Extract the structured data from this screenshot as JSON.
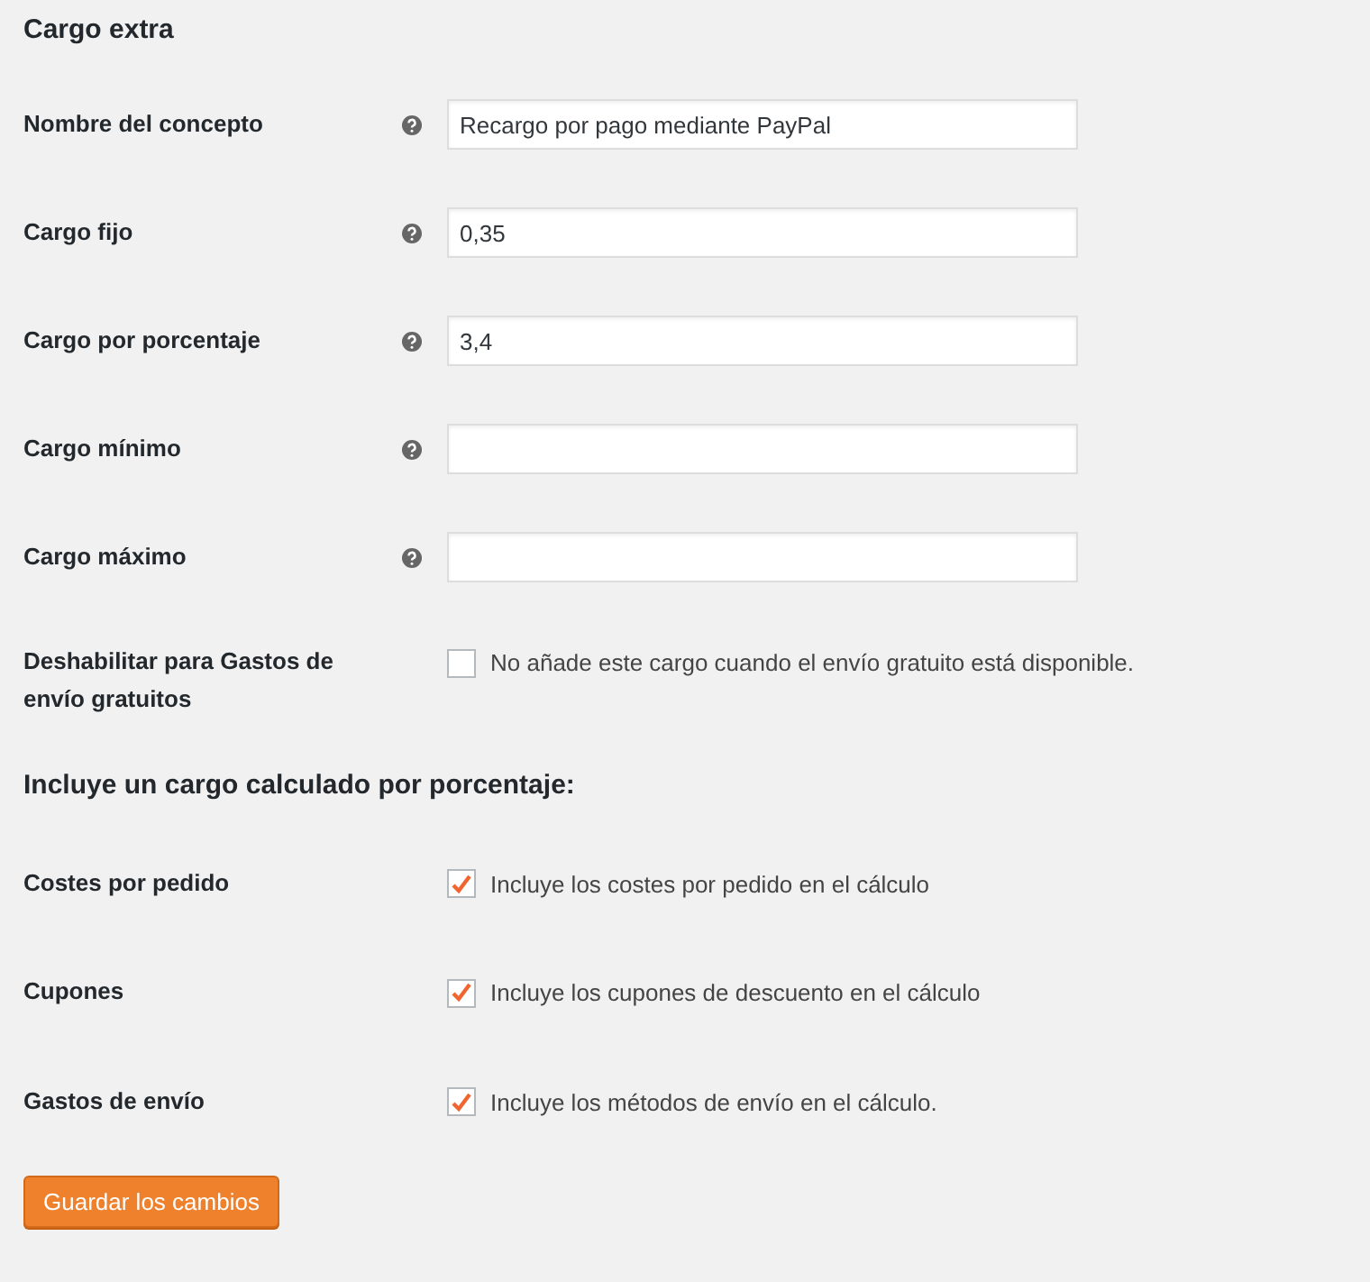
{
  "title": "Cargo extra",
  "fields": [
    {
      "label": "Nombre del concepto",
      "value": "Recargo por pago mediante PayPal"
    },
    {
      "label": "Cargo fijo",
      "value": "0,35"
    },
    {
      "label": "Cargo por porcentaje",
      "value": "3,4"
    },
    {
      "label": "Cargo mínimo"
    },
    {
      "label": "Cargo máximo"
    }
  ],
  "free_shipping": {
    "label": "Deshabilitar para Gastos de envío gratuitos",
    "option": "No añade este cargo cuando el envío gratuito está disponible.",
    "checked": false
  },
  "section_title": "Incluye un cargo calculado por porcentaje:",
  "includes": [
    {
      "label": "Costes por pedido",
      "option": "Incluye los costes por pedido en el cálculo",
      "checked": true
    },
    {
      "label": "Cupones",
      "option": "Incluye los cupones de descuento en el cálculo",
      "checked": true
    },
    {
      "label": "Gastos de envío",
      "option": "Incluye los métodos de envío en el cálculo.",
      "checked": true
    }
  ],
  "save_button": "Guardar los cambios"
}
